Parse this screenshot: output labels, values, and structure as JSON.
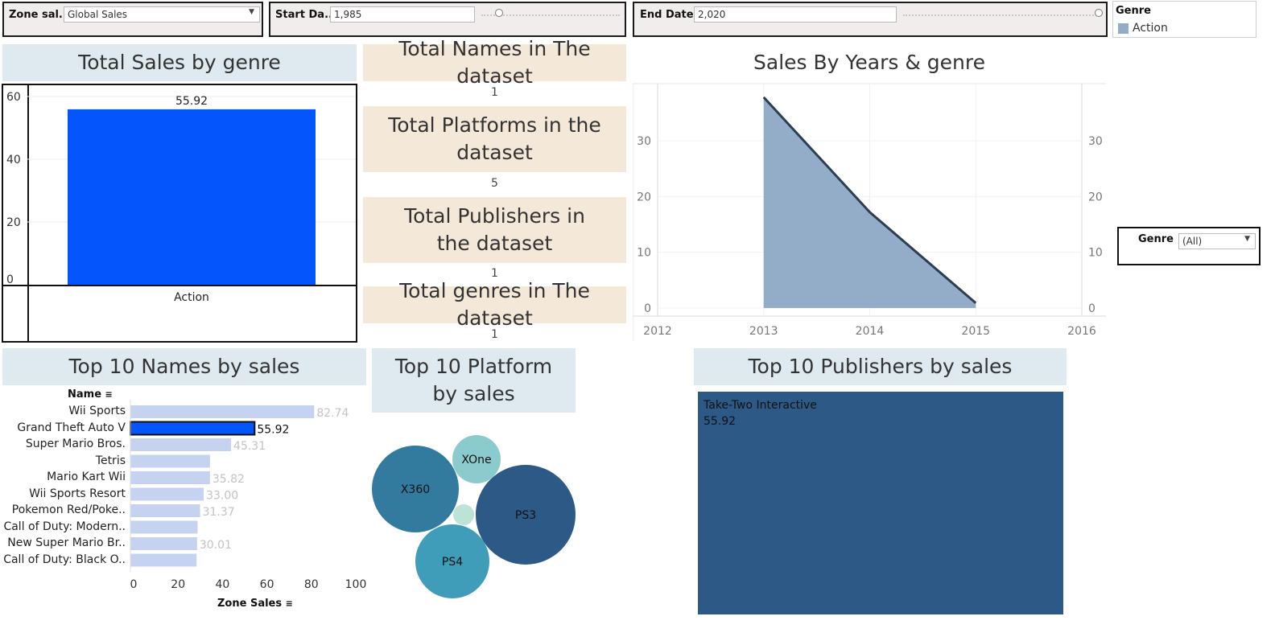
{
  "filters": {
    "zone": {
      "label": "Zone sal..",
      "value": "Global Sales"
    },
    "start": {
      "label": "Start Da..",
      "value": "1,985"
    },
    "end": {
      "label": "End Date",
      "value": "2,020"
    },
    "legend": {
      "title": "Genre",
      "item": "Action",
      "color": "#93acc8"
    },
    "genre_dropdown": {
      "label": "Genre",
      "value": "(All)"
    }
  },
  "genre_chart": {
    "title": "Total Sales by genre",
    "chart_data": {
      "type": "bar",
      "categories": [
        "Action"
      ],
      "values": [
        55.92
      ],
      "value_labels": [
        "55.92"
      ],
      "ylim": [
        0,
        60
      ],
      "yticks": [
        "0",
        "20",
        "40",
        "60"
      ],
      "color": "#0455fb"
    }
  },
  "kpis": [
    {
      "title": "Total Names in The dataset",
      "value": "1"
    },
    {
      "title": "Total Platforms in the dataset",
      "value": "5"
    },
    {
      "title": "Total Publishers in the dataset",
      "value": "1"
    },
    {
      "title": "Total genres in The dataset",
      "value": "1"
    }
  ],
  "years_chart": {
    "title": "Sales By Years & genre",
    "chart_data": {
      "type": "area",
      "x": [
        2013,
        2014,
        2015
      ],
      "y": [
        37.8,
        17.2,
        0.9
      ],
      "xlim": [
        2012,
        2016
      ],
      "xticks": [
        "2012",
        "2013",
        "2014",
        "2015",
        "2016"
      ],
      "ylim": [
        0,
        38
      ],
      "yticks": [
        "0",
        "10",
        "20",
        "30"
      ],
      "fill": "#93acc8",
      "line": "#2c3e50"
    }
  },
  "names_chart": {
    "title": "Top 10 Names by sales",
    "header": "Name",
    "axis_title": "Zone Sales",
    "chart_data": {
      "type": "bar",
      "categories": [
        "Wii Sports",
        "Grand Theft Auto V",
        "Super Mario Bros.",
        "Tetris",
        "Mario Kart Wii",
        "Wii Sports Resort",
        "Pokemon Red/Poke..",
        "Call of Duty: Modern..",
        "New Super Mario Br..",
        "Call of Duty: Black O.."
      ],
      "values": [
        82.74,
        55.92,
        45.31,
        35.84,
        35.82,
        33.0,
        31.37,
        30.26,
        30.01,
        29.8
      ],
      "value_labels": [
        "82.74",
        "55.92",
        "45.31",
        "",
        "35.82",
        "33.00",
        "31.37",
        "",
        "30.01",
        ""
      ],
      "highlight": "Grand Theft Auto V",
      "xlim": [
        0,
        100
      ],
      "xticks": [
        "0",
        "20",
        "40",
        "60",
        "80",
        "100"
      ],
      "color": "#c5d3f1",
      "highlight_color": "#0455fb"
    }
  },
  "platform_chart": {
    "title": "Top 10 Platform by sales",
    "chart_data": {
      "type": "bubble",
      "labels": [
        "PS3",
        "X360",
        "PS4",
        "XOne",
        ""
      ],
      "colors": [
        "#2d5987",
        "#327b9e",
        "#3f9db9",
        "#8ccbcd",
        "#bce3d6"
      ]
    }
  },
  "publisher_chart": {
    "title": "Top 10 Publishers by sales",
    "chart_data": {
      "type": "treemap",
      "labels": [
        "Take-Two Interactive"
      ],
      "values": [
        "55.92"
      ],
      "color": "#2d5987"
    }
  }
}
